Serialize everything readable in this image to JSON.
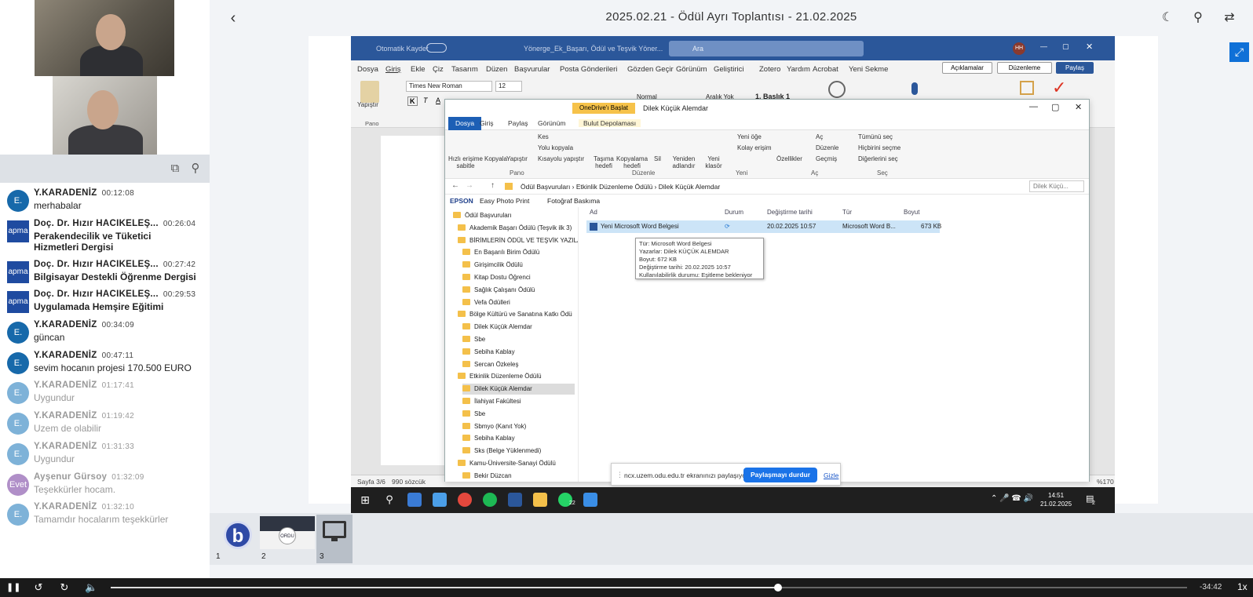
{
  "meeting": {
    "title": "2025.02.21 - Ödül Ayrı Toplantısı - 21.02.2025"
  },
  "chat": {
    "messages": [
      {
        "avatar": "E.",
        "avatar_color": "#1769aa",
        "name": "Y.KARADENİZ",
        "time": "00:12:08",
        "text": "merhabalar",
        "faded": false,
        "bold_text": false
      },
      {
        "avatar": "apma",
        "avatar_color": "#1f4ba0",
        "name": "Doç. Dr. Hızır HACIKELEŞ...",
        "time": "00:26:04",
        "text": "Perakendecilik ve Tüketici Hizmetleri Dergisi",
        "faded": false,
        "bold_text": true
      },
      {
        "avatar": "apma",
        "avatar_color": "#1f4ba0",
        "name": "Doç. Dr. Hızır HACIKELEŞ...",
        "time": "00:27:42",
        "text": "Bilgisayar Destekli Öğrenme Dergisi",
        "faded": false,
        "bold_text": true
      },
      {
        "avatar": "apma",
        "avatar_color": "#1f4ba0",
        "name": "Doç. Dr. Hızır HACIKELEŞ...",
        "time": "00:29:53",
        "text": "Uygulamada Hemşire Eğitimi",
        "faded": false,
        "bold_text": true
      },
      {
        "avatar": "E.",
        "avatar_color": "#1769aa",
        "name": "Y.KARADENİZ",
        "time": "00:34:09",
        "text": "güncan",
        "faded": false,
        "bold_text": false
      },
      {
        "avatar": "E.",
        "avatar_color": "#1769aa",
        "name": "Y.KARADENİZ",
        "time": "00:47:11",
        "text": "sevim hocanın projesi 170.500 EURO",
        "faded": false,
        "bold_text": false
      },
      {
        "avatar": "E.",
        "avatar_color": "#7eb2d8",
        "name": "Y.KARADENİZ",
        "time": "01:17:41",
        "text": "Uygundur",
        "faded": true,
        "bold_text": false
      },
      {
        "avatar": "E.",
        "avatar_color": "#7eb2d8",
        "name": "Y.KARADENİZ",
        "time": "01:19:42",
        "text": "Uzem de olabilir",
        "faded": true,
        "bold_text": false
      },
      {
        "avatar": "E.",
        "avatar_color": "#7eb2d8",
        "name": "Y.KARADENİZ",
        "time": "01:31:33",
        "text": "Uygundur",
        "faded": true,
        "bold_text": false
      },
      {
        "avatar": "Evet",
        "avatar_color": "#b08fc8",
        "name": "Ayşenur Gürsoy",
        "time": "01:32:09",
        "text": "Teşekkürler hocam.",
        "faded": true,
        "bold_text": false
      },
      {
        "avatar": "E.",
        "avatar_color": "#7eb2d8",
        "name": "Y.KARADENİZ",
        "time": "01:32:10",
        "text": "Tamamdır hocalarım teşekkürler",
        "faded": true,
        "bold_text": false
      }
    ]
  },
  "word": {
    "autosave": "Otomatik Kaydet",
    "doc_name": "Yönerge_Ek_Başarı, Ödül ve Teşvik Yöner...",
    "search": "Ara",
    "user_initials": "HH",
    "menu": [
      "Dosya",
      "Giriş",
      "Ekle",
      "Çiz",
      "Tasarım",
      "Düzen",
      "Başvurular",
      "Posta Gönderileri",
      "Gözden Geçir",
      "Görünüm",
      "Geliştirici",
      "Zotero",
      "Yardım",
      "Acrobat",
      "Yeni Sekme"
    ],
    "comments_btn": "Açıklamalar",
    "editing_btn": "Düzenleme",
    "share_btn": "Paylaş",
    "font_name": "Times New Roman",
    "font_size": "12",
    "paste": "Yapıştır",
    "pano": "Pano",
    "style_normal": "Normal",
    "style_nospace": "Aralık Yok",
    "style_h1": "1. Başlık 1",
    "status_page": "Sayfa 3/6",
    "status_words": "990 sözcük",
    "zoom": "%170"
  },
  "explorer": {
    "onedrive": "OneDrive'ı Başlat",
    "window_title": "Dilek Küçük Alemdar",
    "tabs": [
      "Dosya",
      "Giriş",
      "Paylaş",
      "Görünüm",
      "Bulut Depolaması"
    ],
    "ribbon": {
      "pin": "Hızlı erişime sabitle",
      "copy": "Kopyala",
      "paste": "Yapıştır",
      "cut": "Kes",
      "copy_path": "Yolu kopyala",
      "paste_shortcut": "Kısayolu yapıştır",
      "group_pano": "Pano",
      "move": "Taşıma hedefi",
      "copyto": "Kopyalama hedefi",
      "delete": "Sil",
      "rename": "Yeniden adlandır",
      "group_organize": "Düzenle",
      "new_folder": "Yeni klasör",
      "new_item": "Yeni öğe",
      "easy_access": "Kolay erişim",
      "group_new": "Yeni",
      "properties": "Özellikler",
      "open": "Aç",
      "edit": "Düzenle",
      "history": "Geçmiş",
      "group_open": "Aç",
      "select_all": "Tümünü seç",
      "select_none": "Hiçbirini seçme",
      "invert": "Diğerlerini seç",
      "group_select": "Seç"
    },
    "path": "Ödül Başvuruları  ›  Etkinlik Düzenleme Ödülü  ›  Dilek Küçük Alemdar",
    "search_placeholder": "Dilek Küçü...",
    "fav_epson": "EPSON",
    "fav_easy": "Easy Photo Print",
    "fav_photo": "Fotoğraf Baskıma",
    "tree": [
      {
        "label": "Ödül Başvuruları",
        "indent": 0,
        "selected": false
      },
      {
        "label": "Akademik Başarı Ödülü (Teşvik ilk 3)",
        "indent": 1,
        "selected": false
      },
      {
        "label": "BİRİMLERİN ÖDÜL VE TEŞVİK YAZILA",
        "indent": 1,
        "selected": false
      },
      {
        "label": "En Başarılı Birim Ödülü",
        "indent": 2,
        "selected": false
      },
      {
        "label": "Girişimcilik Ödülü",
        "indent": 2,
        "selected": false
      },
      {
        "label": "Kitap Dostu Öğrenci",
        "indent": 2,
        "selected": false
      },
      {
        "label": "Sağlık Çalışanı Ödülü",
        "indent": 2,
        "selected": false
      },
      {
        "label": "Vefa Ödülleri",
        "indent": 2,
        "selected": false
      },
      {
        "label": "Bölge Kültürü ve Sanatına Katkı Ödü",
        "indent": 1,
        "selected": false
      },
      {
        "label": "Dilek Küçük Alemdar",
        "indent": 2,
        "selected": false
      },
      {
        "label": "Sbe",
        "indent": 2,
        "selected": false
      },
      {
        "label": "Sebiha Kablay",
        "indent": 2,
        "selected": false
      },
      {
        "label": "Sercan Özkeleş",
        "indent": 2,
        "selected": false
      },
      {
        "label": "Etkinlik Düzenleme Ödülü",
        "indent": 1,
        "selected": false
      },
      {
        "label": "Dilek Küçük Alemdar",
        "indent": 2,
        "selected": true
      },
      {
        "label": "İlahiyat Fakültesi",
        "indent": 2,
        "selected": false
      },
      {
        "label": "Sbe",
        "indent": 2,
        "selected": false
      },
      {
        "label": "Sbmyo (Kanıt Yok)",
        "indent": 2,
        "selected": false
      },
      {
        "label": "Sebiha Kablay",
        "indent": 2,
        "selected": false
      },
      {
        "label": "Sks (Belge Yüklenmedi)",
        "indent": 2,
        "selected": false
      },
      {
        "label": "Kamu-Üniversite-Sanayi Ödülü",
        "indent": 1,
        "selected": false
      },
      {
        "label": "Bekir Düzcan",
        "indent": 2,
        "selected": false
      }
    ],
    "columns": {
      "name": "Ad",
      "status": "Durum",
      "modified": "Değiştirme tarihi",
      "type": "Tür",
      "size": "Boyut"
    },
    "file": {
      "name": "Yeni Microsoft Word Belgesi",
      "modified": "20.02.2025 10:57",
      "type": "Microsoft Word B...",
      "size": "673 KB"
    },
    "tooltip": [
      "Tür: Microsoft Word Belgesi",
      "Yazarlar: Dilek KÜÇÜK ALEMDAR",
      "Boyut: 672 KB",
      "Değiştirme tarihi: 20.02.2025 10:57",
      "Kullanılabilirlik durumu: Eşitleme bekleniyor"
    ]
  },
  "share": {
    "text": "ncx.uzem.odu.edu.tr ekranınızı paylaşıyor.",
    "stop": "Paylaşmayı durdur",
    "hide": "Gizle"
  },
  "taskbar": {
    "time": "14:51",
    "date": "21.02.2025",
    "whatsapp_badge": "22",
    "notif_badge": "2"
  },
  "thumbs": [
    {
      "num": "1",
      "kind": "bbb-logo"
    },
    {
      "num": "2",
      "kind": "ordu-slide",
      "label": "ORDU"
    },
    {
      "num": "3",
      "kind": "screen-share"
    }
  ],
  "player": {
    "remaining": "-34:42",
    "speed": "1x",
    "progress": 0.62
  },
  "colors": {
    "accent": "#0f70d7",
    "word_blue": "#2b579a",
    "chat_avatar": "#1769aa"
  }
}
